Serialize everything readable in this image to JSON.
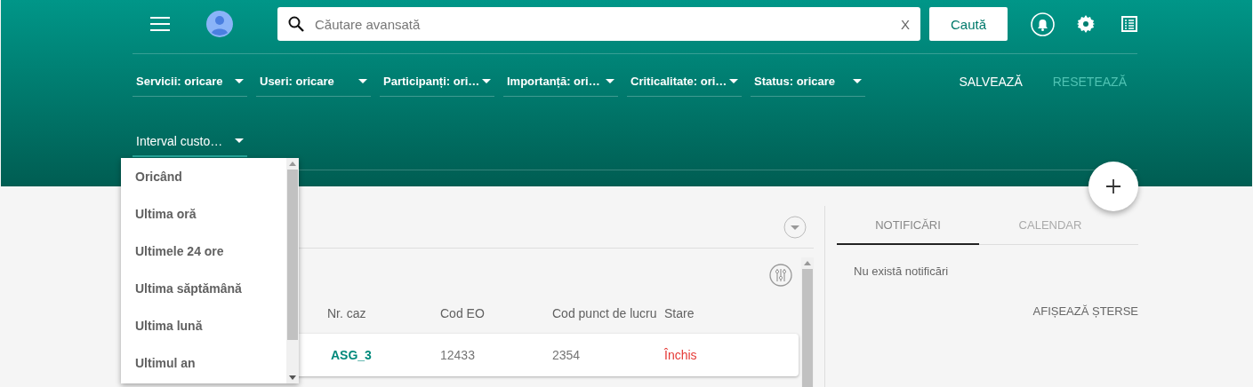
{
  "search": {
    "placeholder": "Căutare avansată",
    "clear": "X",
    "button": "Caută"
  },
  "filters": [
    {
      "label": "Servicii: oricare"
    },
    {
      "label": "Useri: oricare"
    },
    {
      "label": "Participanți: ori…"
    },
    {
      "label": "Importanță: ori…"
    },
    {
      "label": "Criticalitate: ori…"
    },
    {
      "label": "Status: oricare"
    }
  ],
  "actions": [
    {
      "label": "SALVEAZĂ",
      "disabled": false
    },
    {
      "label": "RESETEAZĂ",
      "disabled": true
    }
  ],
  "interval": {
    "label": "Interval custo…",
    "expanded": true,
    "options": [
      {
        "label": "Oricând"
      },
      {
        "label": "Ultima oră"
      },
      {
        "label": "Ultimele 24 ore"
      },
      {
        "label": "Ultima săptămână"
      },
      {
        "label": "Ultima lună"
      },
      {
        "label": "Ultimul an"
      }
    ]
  },
  "table": {
    "columns": [
      "Nr. caz",
      "Cod EO",
      "Cod punct de lucru",
      "Stare"
    ],
    "rows": [
      {
        "cells": [
          "ASG_3",
          "12433",
          "2354",
          "Închis"
        ]
      }
    ]
  },
  "side": {
    "tabs": [
      {
        "label": "NOTIFICĂRI",
        "selected": true
      },
      {
        "label": "CALENDAR",
        "selected": false
      }
    ],
    "empty": "Nu există notificări",
    "link": "AFIȘEAZĂ ȘTERSE"
  }
}
